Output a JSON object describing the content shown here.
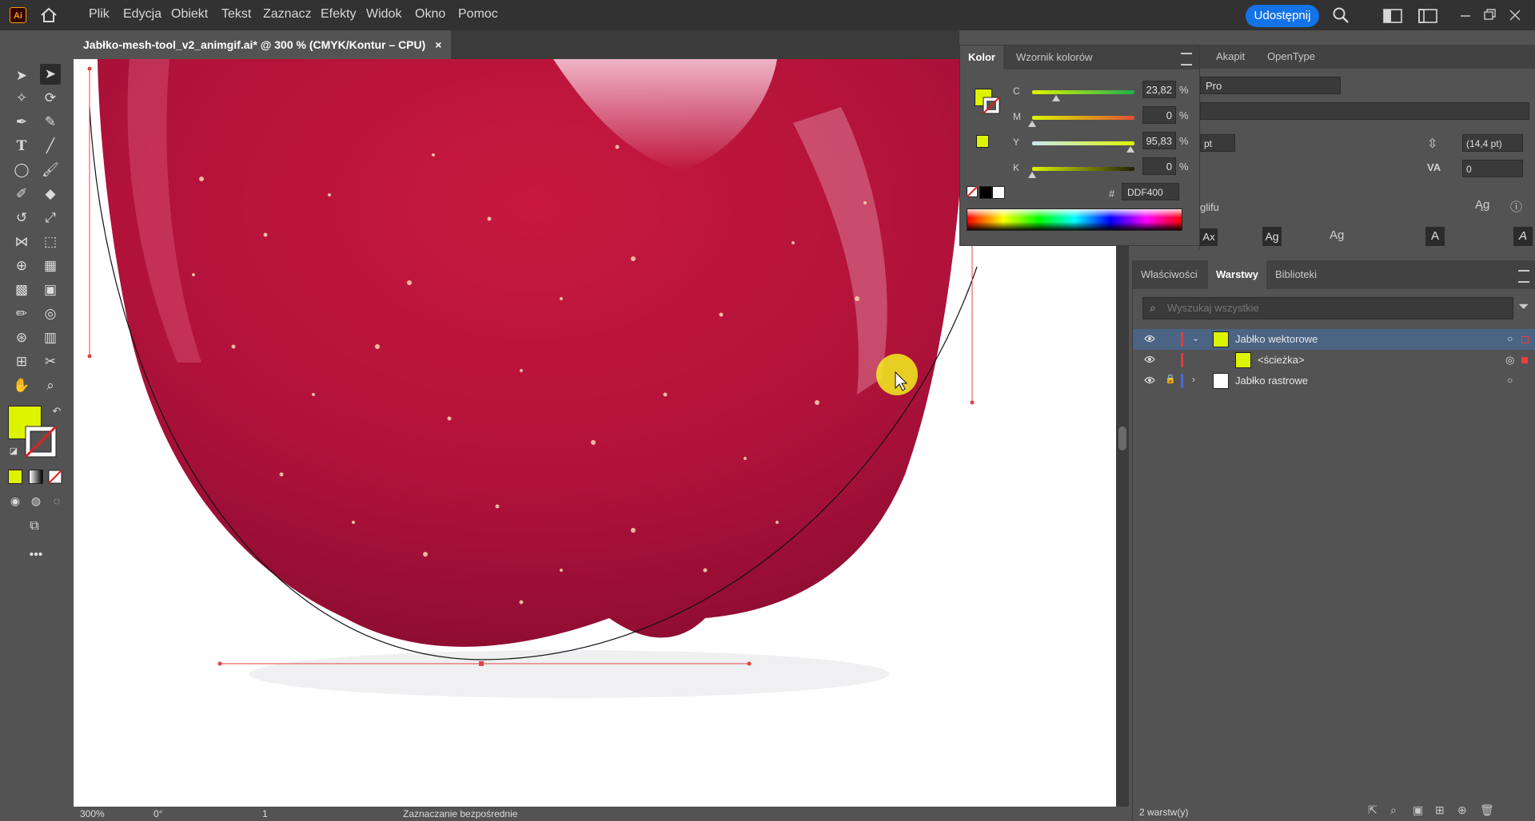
{
  "app": {
    "logo": "Ai"
  },
  "menu": [
    "Plik",
    "Edycja",
    "Obiekt",
    "Tekst",
    "Zaznacz",
    "Efekty",
    "Widok",
    "Okno",
    "Pomoc"
  ],
  "share_label": "Udostępnij",
  "document": {
    "tab_title": "Jabłko-mesh-tool_v2_animgif.ai* @ 300 % (CMYK/Kontur – CPU)",
    "close_glyph": "×"
  },
  "status": {
    "zoom": "300%",
    "rotation": "0°",
    "artboard": "1",
    "tool_name": "Zaznaczanie bezpośrednie",
    "layers_count": "2 warstw(y)"
  },
  "color_panel": {
    "tabs": [
      "Kolor",
      "Wzornik kolorów"
    ],
    "fill_color": "#DDF400",
    "channels": [
      {
        "label": "C",
        "value": "23,82",
        "unit": "%",
        "level": 0.2382
      },
      {
        "label": "M",
        "value": "0",
        "unit": "%",
        "level": 0
      },
      {
        "label": "Y",
        "value": "95,83",
        "unit": "%",
        "level": 0.9583
      },
      {
        "label": "K",
        "value": "0",
        "unit": "%",
        "level": 0
      }
    ],
    "hex_label": "#",
    "hex_value": "DDF400"
  },
  "char_panel": {
    "tabs": [
      "Akapit",
      "OpenType"
    ],
    "font_family": "Pro",
    "font_style": "",
    "size_partial": "pt",
    "leading": "(14,4 pt)",
    "tracking": "0",
    "glyph_label": "glifu"
  },
  "layers_panel": {
    "tabs": [
      "Właściwości",
      "Warstwy",
      "Biblioteki"
    ],
    "search_placeholder": "Wyszukaj wszystkie",
    "layers": [
      {
        "name": "Jabłko wektorowe",
        "selected": true,
        "color": "#d84040"
      },
      {
        "name": "<ścieżka>",
        "selected": false,
        "color": "#d84040"
      },
      {
        "name": "Jabłko rastrowe",
        "selected": false,
        "color": "#4a6ad8"
      }
    ]
  },
  "colors": {
    "accent": "#1473e6",
    "fill": "#DDF400",
    "path_handle": "#e84040"
  }
}
